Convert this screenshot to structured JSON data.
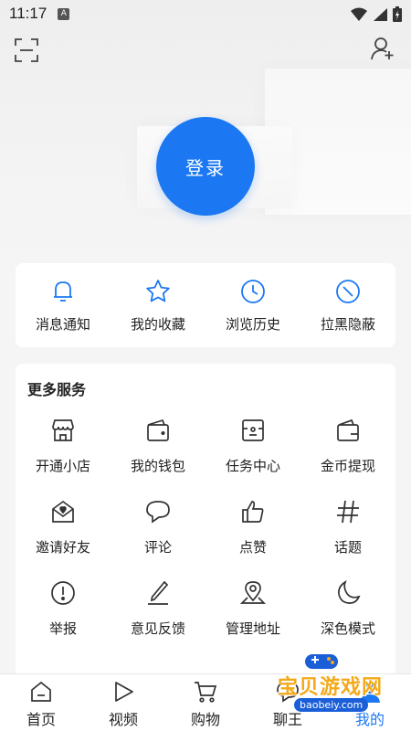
{
  "status_bar": {
    "time": "11:17",
    "input_indicator": "A"
  },
  "header": {
    "login_label": "登录"
  },
  "quick_actions": [
    {
      "label": "消息通知",
      "icon": "bell-icon"
    },
    {
      "label": "我的收藏",
      "icon": "star-icon"
    },
    {
      "label": "浏览历史",
      "icon": "clock-icon"
    },
    {
      "label": "拉黑隐蔽",
      "icon": "block-icon"
    }
  ],
  "services": {
    "title": "更多服务",
    "items": [
      {
        "label": "开通小店",
        "icon": "shop-icon"
      },
      {
        "label": "我的钱包",
        "icon": "wallet-icon"
      },
      {
        "label": "任务中心",
        "icon": "task-icon"
      },
      {
        "label": "金币提现",
        "icon": "coin-withdraw-icon"
      },
      {
        "label": "邀请好友",
        "icon": "invite-icon"
      },
      {
        "label": "评论",
        "icon": "comment-icon"
      },
      {
        "label": "点赞",
        "icon": "thumbs-up-icon"
      },
      {
        "label": "话题",
        "icon": "hashtag-icon"
      },
      {
        "label": "举报",
        "icon": "report-icon"
      },
      {
        "label": "意见反馈",
        "icon": "pen-icon"
      },
      {
        "label": "管理地址",
        "icon": "location-icon"
      },
      {
        "label": "深色模式",
        "icon": "moon-icon"
      }
    ]
  },
  "tabbar": [
    {
      "label": "首页",
      "icon": "home-icon"
    },
    {
      "label": "视频",
      "icon": "play-icon"
    },
    {
      "label": "购物",
      "icon": "cart-icon"
    },
    {
      "label": "聊王",
      "icon": "chat-icon"
    },
    {
      "label": "我的",
      "icon": "profile-icon",
      "active": true
    }
  ],
  "watermark": {
    "text": "宝贝游戏网",
    "url": "baobeiy.com"
  },
  "colors": {
    "accent": "#1b78f2",
    "background": "#f5f5f5",
    "card": "#ffffff"
  }
}
